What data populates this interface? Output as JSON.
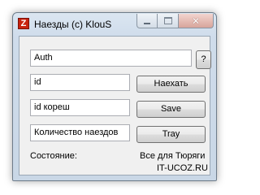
{
  "window": {
    "title": "Наезды (c) KlouS",
    "app_icon_letter": "Z",
    "close_glyph": "✕"
  },
  "form": {
    "auth_value": "Auth",
    "help_label": "?",
    "id_value": "id",
    "naekhat_label": "Наехать",
    "friend_id_value": "id кореш",
    "save_label": "Save",
    "count_value": "Количество наездов",
    "tray_label": "Tray",
    "status_label": "Состояние:",
    "footer_line1": "Все для Тюряги",
    "footer_line2": "IT-UCOZ.RU"
  },
  "colors": {
    "app_icon": "#c8220e",
    "close_button": "#d7a59b",
    "window_frame": "#cfdceb"
  }
}
